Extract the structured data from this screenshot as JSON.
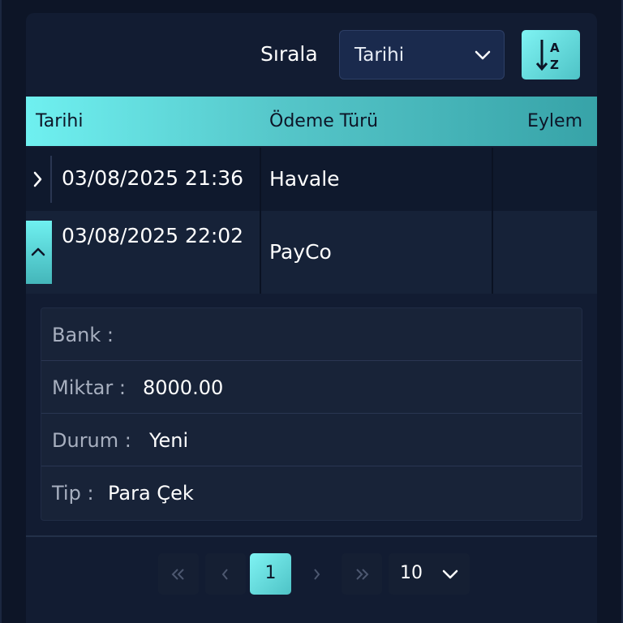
{
  "sort": {
    "label": "Sırala",
    "selected": "Tarihi",
    "button_icon": "sort-alpha-icon"
  },
  "table": {
    "headers": [
      "Tarihi",
      "Ödeme Türü",
      "Eylem"
    ],
    "rows": [
      {
        "date": "03/08/2025 21:36",
        "type": "Havale",
        "action": "",
        "expanded": false
      },
      {
        "date": "03/08/2025 22:02",
        "type": "PayCo",
        "action": "",
        "expanded": true
      }
    ]
  },
  "details": {
    "bank_key": "Bank :",
    "bank_value": "",
    "amount_key": "Miktar :",
    "amount_value": "8000.00",
    "status_key": "Durum :",
    "status_value": "Yeni",
    "type_key": "Tip :",
    "type_value": "Para Çek"
  },
  "pagination": {
    "current_page": "1",
    "page_size": "10"
  },
  "colors": {
    "accent": "#6ff0f0",
    "background": "#0d1527",
    "panel": "#121c32"
  }
}
